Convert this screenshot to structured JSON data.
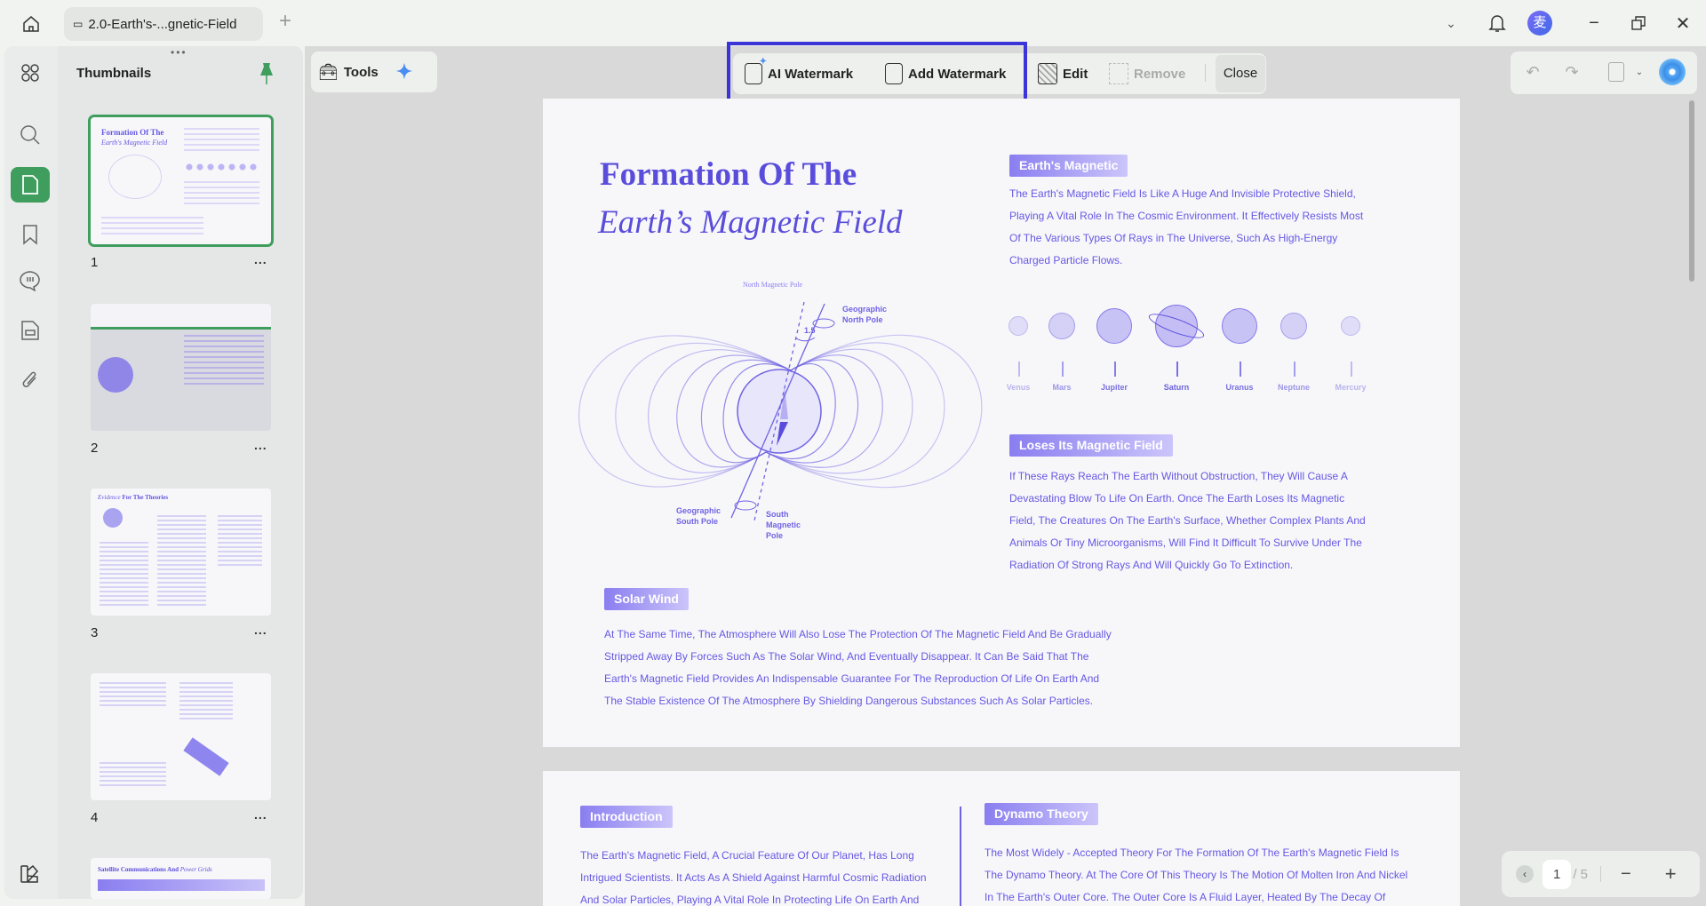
{
  "titlebar": {
    "tab_title": "2.0-Earth's-...gnetic-Field",
    "new_tab": "+",
    "avatar_text": "麦"
  },
  "sidebar": {
    "panel_title": "Thumbnails",
    "thumbnails": [
      {
        "number": "1",
        "more": "...",
        "title": "Formation Of The",
        "subtitle": "Earth's Magnetic Field"
      },
      {
        "number": "2",
        "more": "..."
      },
      {
        "number": "3",
        "more": "...",
        "title_italic": "Evidence",
        "title": "For The Theories"
      },
      {
        "number": "4",
        "more": "..."
      },
      {
        "title": "Satellite Communications And",
        "title_italic": "Power Grids"
      }
    ]
  },
  "toolbar": {
    "tools": "Tools",
    "ai_watermark": "AI Watermark",
    "add_watermark": "Add Watermark",
    "edit": "Edit",
    "remove": "Remove",
    "close": "Close"
  },
  "page1": {
    "title_line1": "Formation Of The",
    "title_line2": "Earth’s Magnetic Field",
    "earth_badge": "Earth's Magnetic",
    "earth_lines": [
      "The Earth's Magnetic Field Is Like A Huge And Invisible Protective Shield,",
      "Playing A Vital Role In The Cosmic Environment. It Effectively Resists Most",
      "Of The Various Types Of Rays in The Universe, Such As High-Energy",
      "Charged Particle Flows."
    ],
    "planets": [
      "Venus",
      "Mars",
      "Jupiter",
      "Saturn",
      "Uranus",
      "Neptune",
      "Mercury"
    ],
    "loses_badge": "Loses Its Magnetic Field",
    "loses_lines": [
      "If These Rays Reach The Earth Without Obstruction, They Will Cause A",
      "Devastating Blow To Life On Earth. Once The Earth Loses Its Magnetic",
      "Field, The Creatures On The Earth's Surface, Whether Complex Plants And",
      "Animals Or Tiny Microorganisms, Will Find It Difficult To Survive Under The",
      "Radiation Of Strong Rays And Will Quickly Go To Extinction."
    ],
    "diagram": {
      "north_magnetic": "North Magnetic Pole",
      "geo_north_1": "Geographic",
      "geo_north_2": "North Pole",
      "geo_south_1": "Geographic",
      "geo_south_2": "South Pole",
      "south_mag_1": "South",
      "south_mag_2": "Magnetic",
      "south_mag_3": "Pole",
      "angle": "1.5"
    },
    "solar_badge": "Solar Wind",
    "solar_lines": [
      "At The Same Time, The Atmosphere Will Also Lose The Protection Of The Magnetic Field And Be Gradually",
      "Stripped Away By Forces Such As The Solar Wind, And Eventually Disappear. It Can Be Said That The",
      "Earth's Magnetic Field Provides An Indispensable Guarantee For The Reproduction Of Life On Earth And",
      "The Stable Existence Of The Atmosphere By Shielding Dangerous Substances Such As Solar Particles."
    ]
  },
  "page2": {
    "intro_badge": "Introduction",
    "intro_lines": [
      "The Earth's Magnetic Field, A Crucial Feature Of Our Planet, Has Long",
      "Intrigued Scientists. It Acts As A Shield Against Harmful Cosmic Radiation",
      "And Solar Particles, Playing A Vital Role In Protecting Life On Earth And"
    ],
    "dynamo_badge": "Dynamo Theory",
    "dynamo_lines": [
      "The Most Widely - Accepted Theory For The Formation Of The Earth's Magnetic Field Is",
      "The Dynamo Theory. At The Core Of This Theory Is The Motion Of Molten Iron And Nickel",
      "In The Earth's Outer Core. The Outer Core Is A Fluid Layer, Heated By The Decay Of"
    ]
  },
  "navigation": {
    "current_page": "1",
    "total_pages": "/ 5",
    "zoom_out": "−",
    "zoom_in": "+"
  },
  "colors": {
    "accent": "#3f9e5e",
    "highlight": "#3b35d8",
    "text_purple": "#6558e2"
  }
}
